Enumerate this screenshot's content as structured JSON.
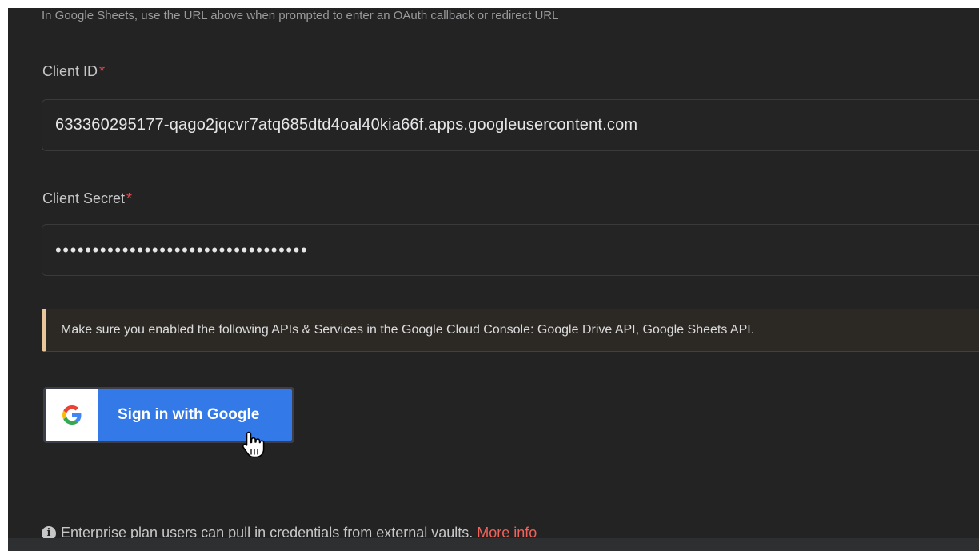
{
  "hint_text": "In Google Sheets, use the URL above when prompted to enter an OAuth callback or redirect URL",
  "client_id": {
    "label": "Client ID",
    "required_mark": "*",
    "value": "633360295177-qago2jqcvr7atq685dtd4oal40kia66f.apps.googleusercontent.com"
  },
  "client_secret": {
    "label": "Client Secret",
    "required_mark": "*",
    "masked_value": "••••••••••••••••••••••••••••••••••"
  },
  "notice": {
    "text": "Make sure you enabled the following APIs & Services in the Google Cloud Console: Google Drive API, Google Sheets API.",
    "accent_color": "#e9c79a"
  },
  "google_button": {
    "label": "Sign in with Google",
    "icon": "google-g-icon",
    "color": "#3479e8"
  },
  "enterprise": {
    "text": "Enterprise plan users can pull in credentials from external vaults.",
    "link_label": "More info",
    "icon": "info-icon",
    "link_color": "#f0625a"
  }
}
